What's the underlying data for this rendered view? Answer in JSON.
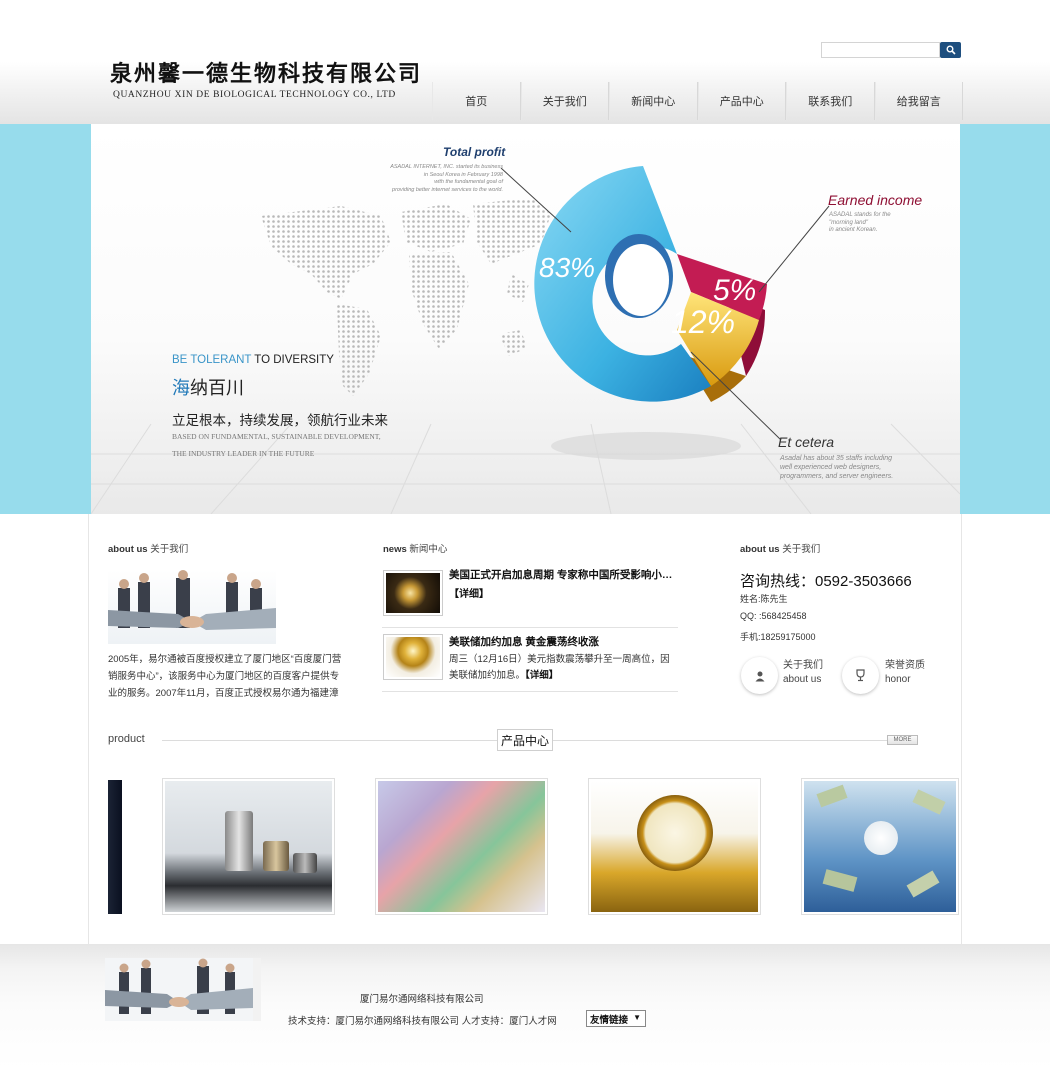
{
  "header": {
    "company_cn": "泉州馨一德生物科技有限公司",
    "company_en": "QUANZHOU XIN DE BIOLOGICAL TECHNOLOGY CO., LTD",
    "search_placeholder": "",
    "search_icon": "search-icon"
  },
  "nav": {
    "items": [
      "首页",
      "关于我们",
      "新闻中心",
      "产品中心",
      "联系我们",
      "给我留言"
    ]
  },
  "banner": {
    "tagline_blue": "BE TOLERANT",
    "tagline_dark": "TO DIVERSITY",
    "cn_highlight": "海",
    "cn_rest": "纳百川",
    "slogan": "立足根本，持续发展，领航行业未来",
    "sub1": "BASED ON FUNDAMENTAL, SUSTAINABLE DEVELOPMENT,",
    "sub2": "THE INDUSTRY LEADER IN THE FUTURE",
    "chart": {
      "total_profit_title": "Total profit",
      "total_profit_desc": [
        "ASADAL INTERNET, INC. started its business",
        "in Seoul Korea in February 1998",
        "with the fundamental goal of",
        "providing better internet services to the world."
      ],
      "earned_income_title": "Earned income",
      "earned_income_desc": [
        "ASADAL stands for the",
        "\"morning land\"",
        "in ancient Korean."
      ],
      "et_cetera_title": "Et cetera",
      "et_cetera_desc": [
        "Asadal has about 35 staffs including",
        "well experienced web designers,",
        "programmers, and server engineers."
      ],
      "pct_large": "83%",
      "pct_medium": "12%",
      "pct_small": "5%",
      "values": [
        83,
        12,
        5
      ],
      "colors": {
        "blue": "#4dbbe6",
        "yellow": "#f0c52a",
        "red": "#b8174a"
      }
    }
  },
  "about": {
    "title_en": "about us",
    "title_cn": "关于我们",
    "text": "2005年，易尔通被百度授权建立了厦门地区“百度厦门营销服务中心”，该服务中心为厦门地区的百度客户提供专业的服务。2007年11月，百度正式授权易尔通为福建漳"
  },
  "news": {
    "title_en": "news",
    "title_cn": "新闻中心",
    "items": [
      {
        "title": "美国正式开启加息周期 专家称中国所受影响小于…",
        "more": "【详细】"
      },
      {
        "title": "美联储加约加息 黄金震荡终收涨",
        "desc": "周三（12月16日）美元指数震荡攀升至一周高位，因美联储加约加息。",
        "more": "【详细】"
      }
    ]
  },
  "contact": {
    "title_en": "about us",
    "title_cn": "关于我们",
    "hotline": "咨询热线：0592-3503666",
    "name": "姓名:陈先生",
    "qq": "QQ: :568425458",
    "phone": "手机:18259175000",
    "about_btn_cn": "关于我们",
    "about_btn_en": "about us",
    "honor_btn_cn": "荣誉资质",
    "honor_btn_en": "honor"
  },
  "product": {
    "label": "product",
    "center": "产品中心",
    "more": "MORE"
  },
  "footer": {
    "company": "厦门易尔通网络科技有限公司",
    "support_prefix": "技术支持：",
    "support_company": "厦门易尔通网络科技有限公司",
    "talent_prefix": "人才支持：",
    "talent_site": "厦门人才网",
    "links_select": "友情链接"
  }
}
